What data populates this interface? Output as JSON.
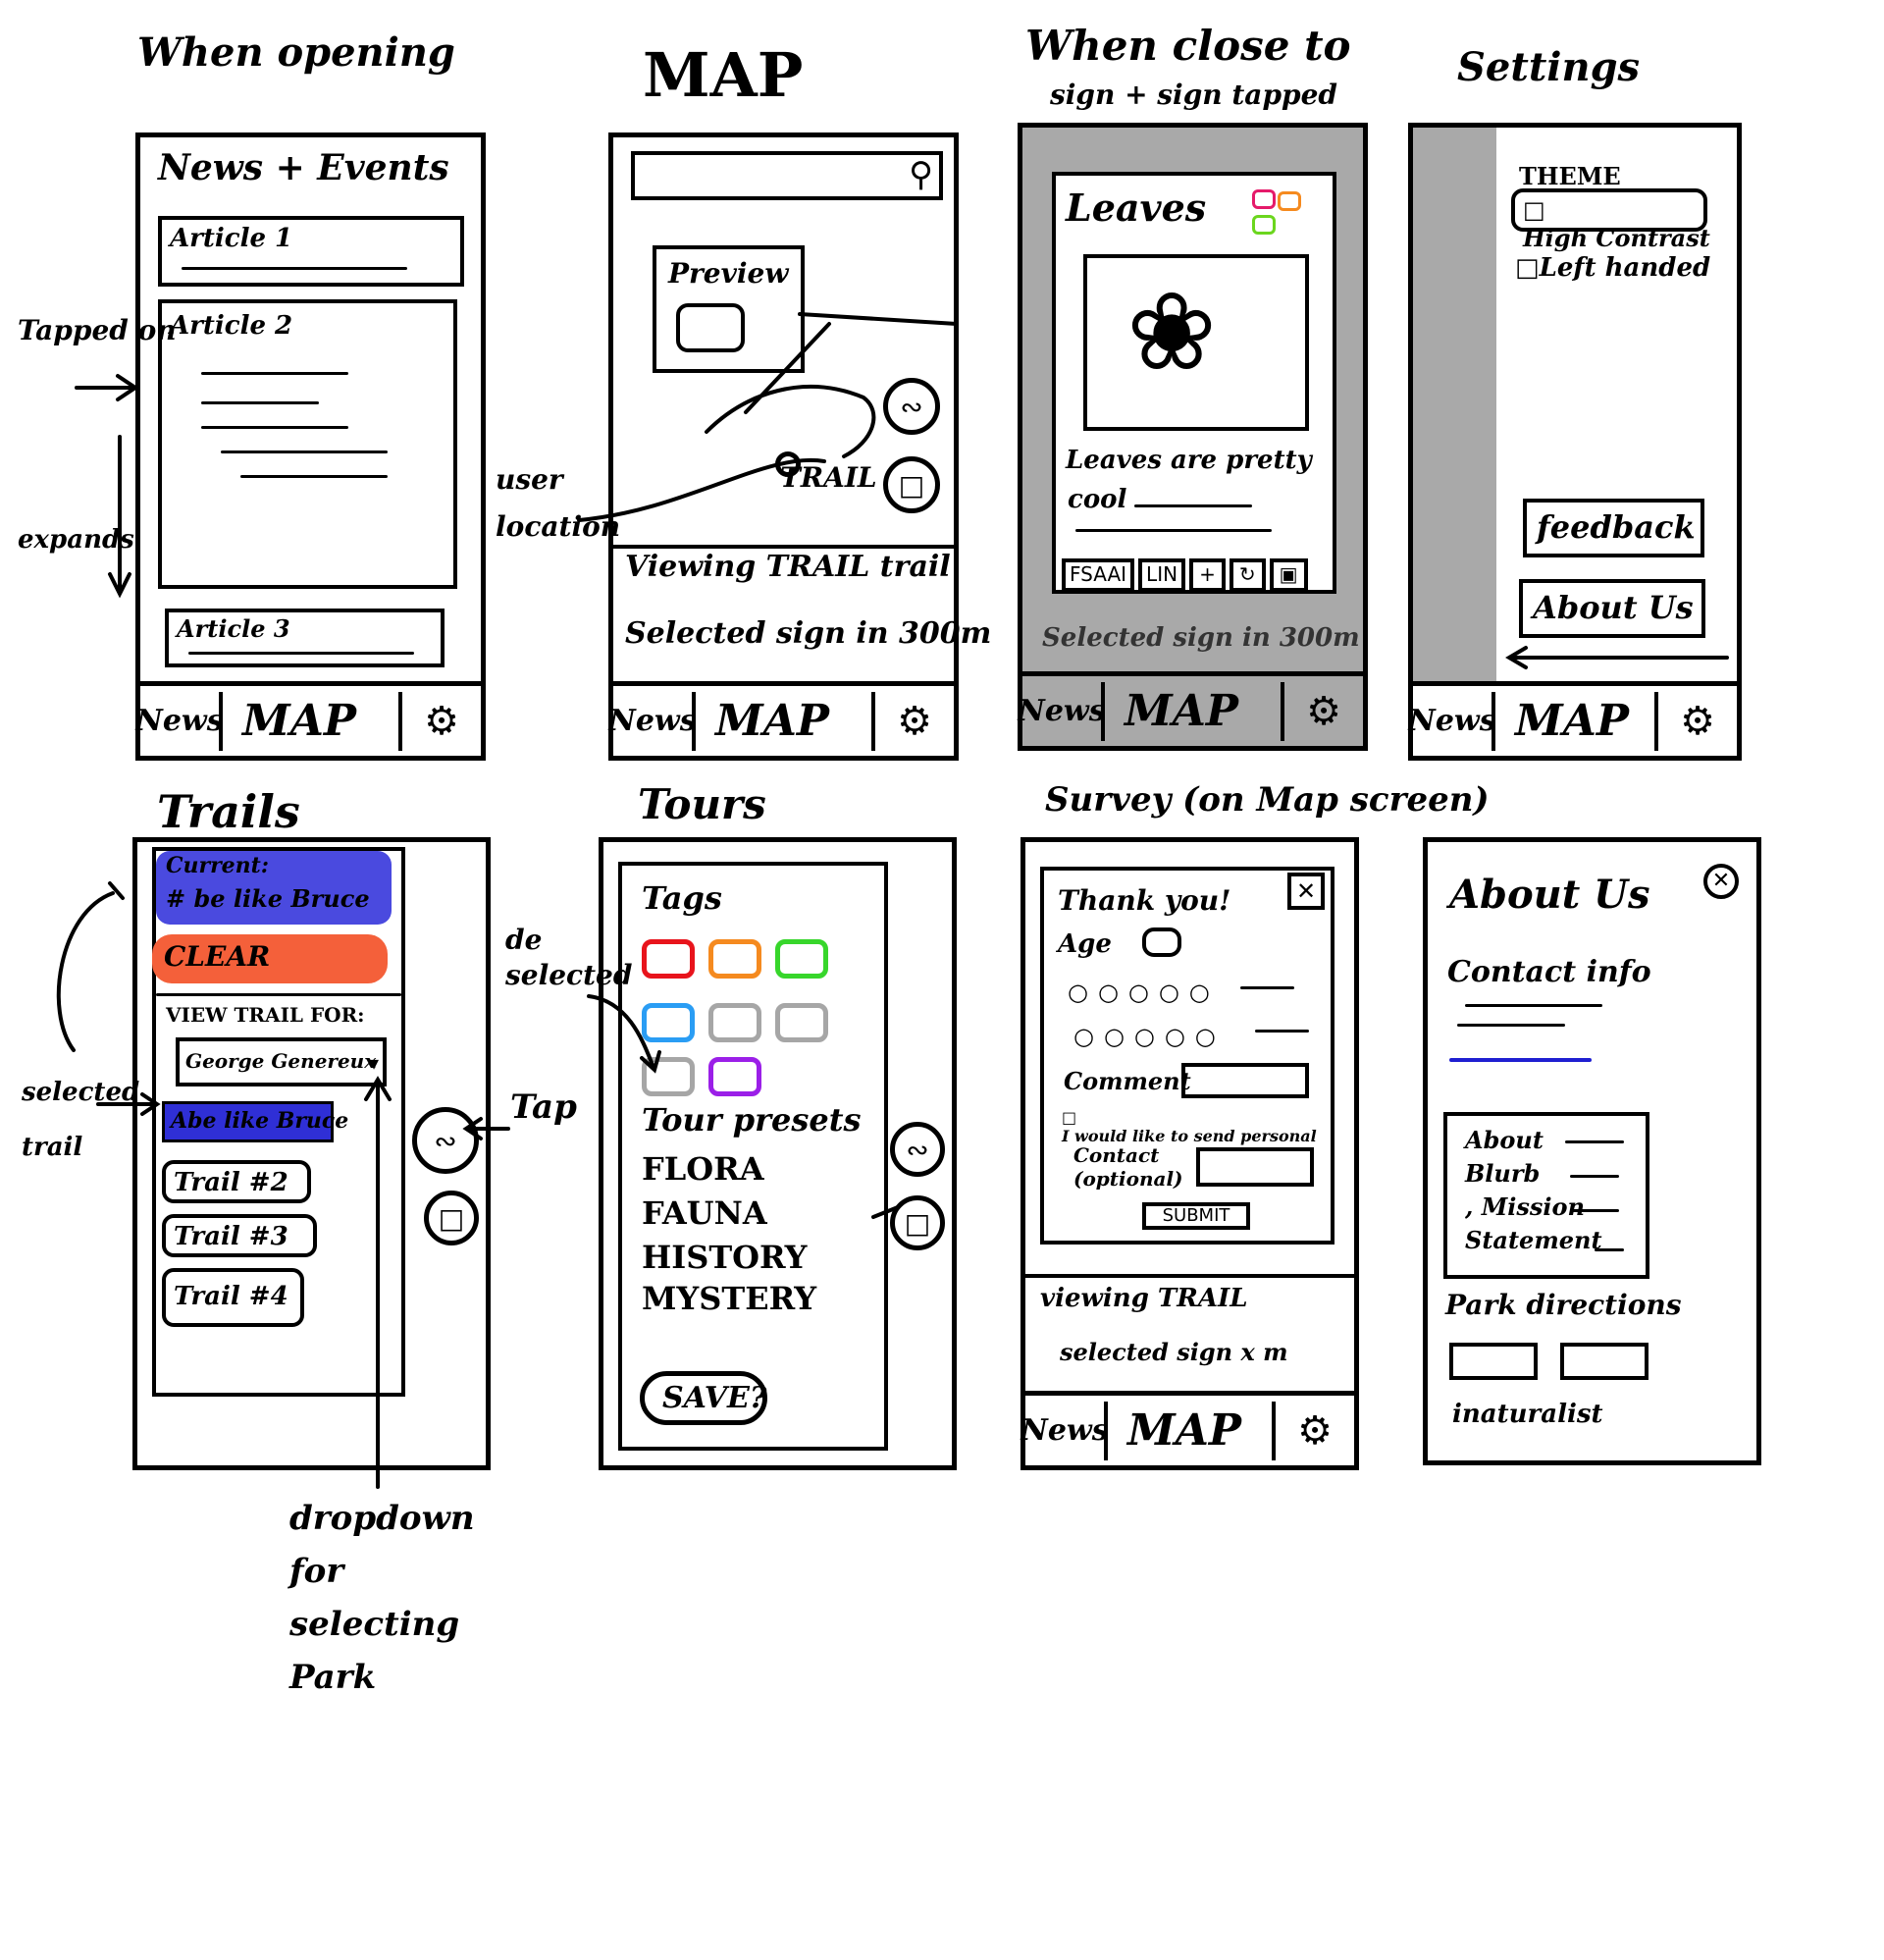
{
  "headings": {
    "opening": "When opening",
    "map": "MAP",
    "sign": "When close to",
    "sign_sub": "sign + sign tapped",
    "settings": "Settings",
    "trails": "Trails",
    "tours": "Tours",
    "survey": "Survey (on Map screen)"
  },
  "nav": {
    "news": "News",
    "map": "MAP",
    "settings_icon": "gear-icon"
  },
  "news_screen": {
    "title": "News + Events",
    "articles": [
      "Article 1",
      "Article 2",
      "Article 3"
    ]
  },
  "map_screen": {
    "preview_label": "Preview",
    "trail_label": "TRAIL",
    "status_line1": "Viewing TRAIL trail",
    "status_line2": "Selected sign in 300m"
  },
  "sign_screen": {
    "title": "Leaves",
    "text_line1": "Leaves are pretty",
    "text_line2": "cool",
    "toolbar": [
      "FSAAI",
      "LIN",
      "+",
      "↻",
      "▣"
    ],
    "status": "Selected sign in 300m"
  },
  "settings_screen": {
    "theme_label": "THEME",
    "high_contrast": "High Contrast",
    "left_handed": "Left handed",
    "feedback_button": "feedback",
    "about_button": "About Us"
  },
  "trails_screen": {
    "current_label": "Current:",
    "current_value": "# be like Bruce",
    "clear_button": "CLEAR",
    "view_trail_for": "VIEW TRAIL FOR:",
    "park_select": "George Genereux",
    "trails": [
      "Abe like Bruce",
      "Trail #2",
      "Trail #3",
      "Trail #4"
    ]
  },
  "tours_screen": {
    "tags_label": "Tags",
    "tag_colors": [
      "#e8141c",
      "#f58a1f",
      "#37d62b",
      "#2a9df4",
      "#a6a6a6",
      "#a6a6a6",
      "#a6a6a6",
      "#9b1fe8"
    ],
    "presets_label": "Tour presets",
    "presets": [
      "FLORA",
      "FAUNA",
      "HISTORY",
      "MYSTERY"
    ],
    "save_button": "SAVE?"
  },
  "survey_screen": {
    "thank_you": "Thank you!",
    "age_label": "Age",
    "comment_label": "Comment",
    "consent": "I would like to send personal",
    "contact_label": "Contact (optional)",
    "submit_button": "SUBMIT",
    "status_line1": "viewing TRAIL",
    "status_line2": "selected sign x m",
    "nav_news": "News",
    "nav_map": "MAP"
  },
  "about_screen": {
    "title": "About Us",
    "contact_info": "Contact info",
    "blurb": [
      "About",
      "Blurb",
      ", Mission",
      "Statement"
    ],
    "park_directions": "Park directions",
    "naturalist": "inaturalist"
  },
  "annotations": {
    "tapped_on": "Tapped on",
    "expands": "expands",
    "user_location": "user location",
    "de_selected": "de selected",
    "tap": "Tap",
    "selected_trail": "selected trail",
    "dropdown_note": "dropdown for selecting Park"
  },
  "colors": {
    "highlight_blue": "#4a4adf",
    "highlight_orange": "#f4603a",
    "accent_blue": "#1f1fd1"
  }
}
